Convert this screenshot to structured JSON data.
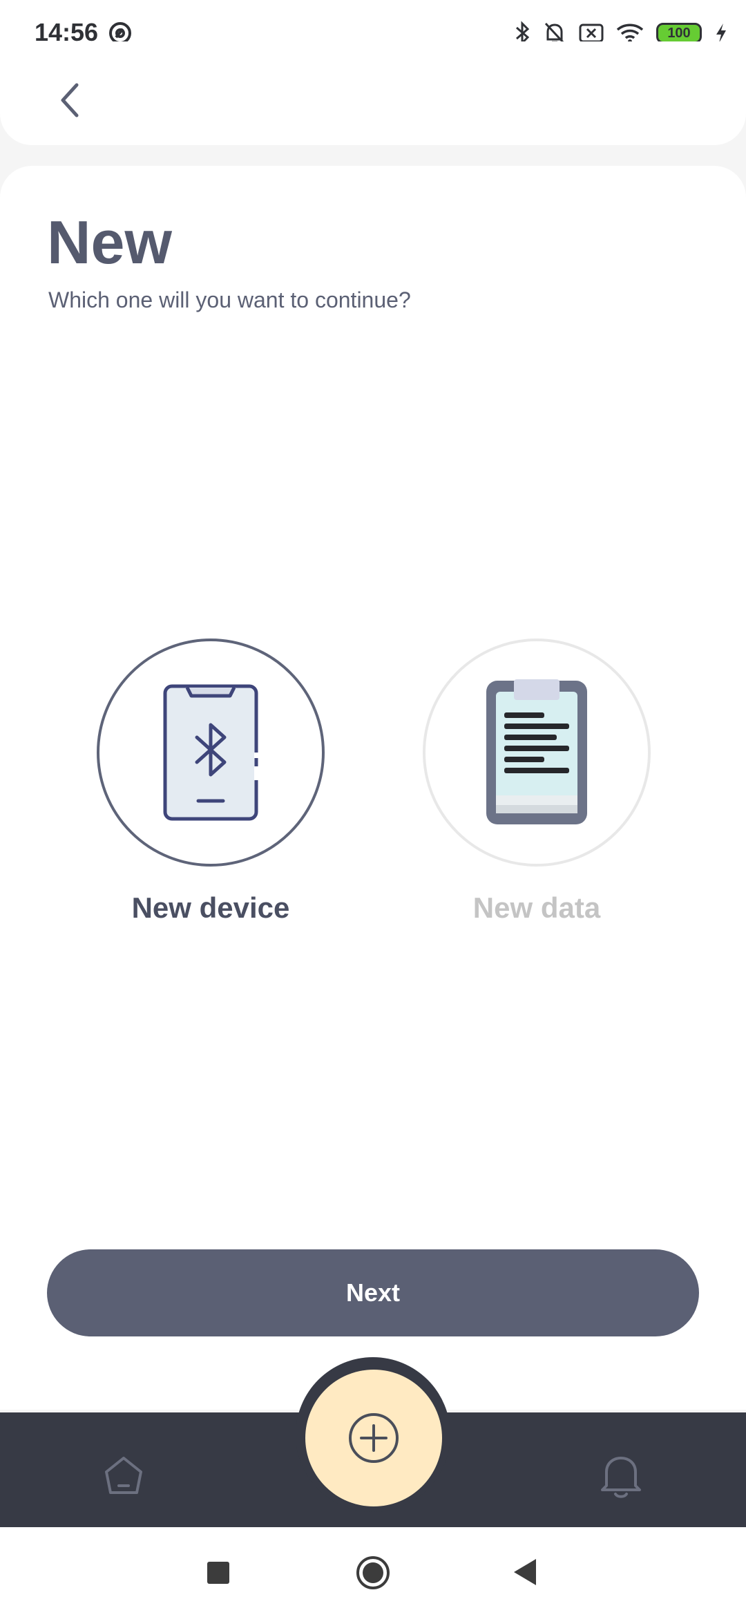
{
  "status_bar": {
    "time": "14:56",
    "battery_level": "100",
    "icons": [
      "at-sign-icon",
      "bluetooth-icon",
      "bell-off-icon",
      "sim-off-icon",
      "wifi-icon",
      "battery-icon",
      "charging-icon"
    ]
  },
  "header": {
    "back_icon": "chevron-left-icon"
  },
  "main": {
    "title": "New",
    "subtitle": "Which one will you want to continue?",
    "options": [
      {
        "label": "New device",
        "icon": "bluetooth-phone-icon",
        "selected": true
      },
      {
        "label": "New data",
        "icon": "clipboard-icon",
        "selected": false
      }
    ],
    "next_label": "Next"
  },
  "bottom_nav": {
    "items": [
      "home-icon",
      "add-icon",
      "bell-icon"
    ]
  },
  "colors": {
    "primary": "#5b6074",
    "nav_background": "#373a45",
    "fab": "#ffeac2",
    "disabled_text": "#c4c4c4"
  }
}
